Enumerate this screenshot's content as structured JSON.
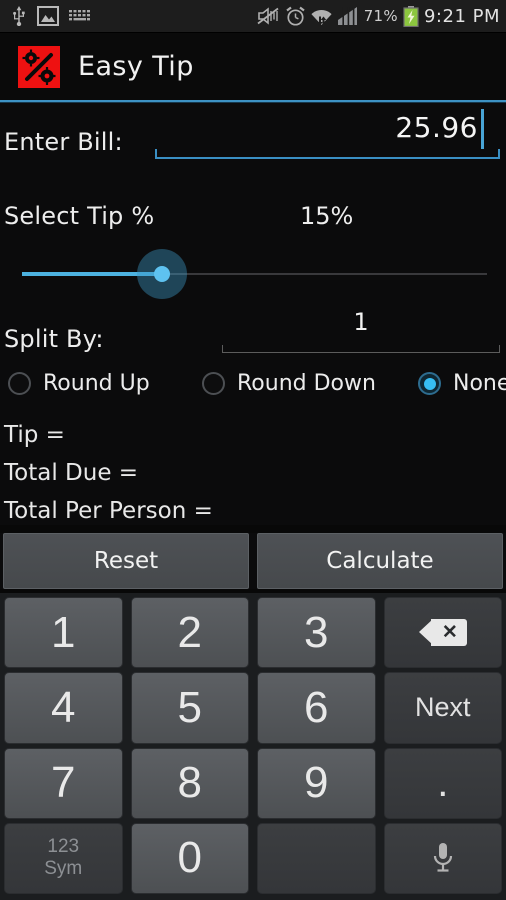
{
  "statusbar": {
    "left_icons": [
      "usb-icon",
      "screenshot-image-icon",
      "keyboard-icon"
    ],
    "right_icons": [
      "mute-vibrate-off-icon",
      "alarm-clock-icon",
      "wifi-icon",
      "signal-bars-icon",
      "battery-charging-icon"
    ],
    "battery_percent": "71%",
    "clock": "9:21 PM"
  },
  "titlebar": {
    "app_icon": "percent-gear-icon",
    "title": "Easy Tip",
    "icon_color": "#ee1111",
    "divider_color": "#3d92c4"
  },
  "form": {
    "bill": {
      "label": "Enter Bill:",
      "value": "25.96",
      "placeholder": "",
      "underline_color": "#3a8fc4"
    },
    "tip": {
      "label": "Select Tip %",
      "percent_display": "15%",
      "slider_value": 15,
      "slider_min": 0,
      "slider_max": 50,
      "slider_fill_pct": 30,
      "accent_color": "#4cb2e0"
    },
    "split": {
      "label": "Split By:",
      "value": "1",
      "placeholder": ""
    },
    "rounding": {
      "options": [
        {
          "label": "Round Up",
          "selected": false
        },
        {
          "label": "Round Down",
          "selected": false
        },
        {
          "label": "None",
          "selected": true
        }
      ]
    },
    "results": [
      "Tip =",
      "Total Due =",
      "Total Per Person ="
    ]
  },
  "actions": {
    "reset_label": "Reset",
    "calculate_label": "Calculate"
  },
  "keyboard": {
    "rows": [
      [
        {
          "label": "1",
          "type": "num",
          "name": "key-1"
        },
        {
          "label": "2",
          "type": "num",
          "name": "key-2"
        },
        {
          "label": "3",
          "type": "num",
          "name": "key-3"
        },
        {
          "label": "",
          "type": "backspace",
          "name": "key-backspace"
        }
      ],
      [
        {
          "label": "4",
          "type": "num",
          "name": "key-4"
        },
        {
          "label": "5",
          "type": "num",
          "name": "key-5"
        },
        {
          "label": "6",
          "type": "num",
          "name": "key-6"
        },
        {
          "label": "Next",
          "type": "fn",
          "name": "key-next"
        }
      ],
      [
        {
          "label": "7",
          "type": "num",
          "name": "key-7"
        },
        {
          "label": "8",
          "type": "num",
          "name": "key-8"
        },
        {
          "label": "9",
          "type": "num",
          "name": "key-9"
        },
        {
          "label": ".",
          "type": "dot",
          "name": "key-period"
        }
      ],
      [
        {
          "label": "123\nSym",
          "type": "sym",
          "name": "key-123-sym"
        },
        {
          "label": "0",
          "type": "num",
          "name": "key-0"
        },
        {
          "label": "",
          "type": "blank",
          "name": "key-blank"
        },
        {
          "label": "",
          "type": "mic",
          "name": "key-microphone"
        }
      ]
    ],
    "sym_line1": "123",
    "sym_line2": "Sym"
  }
}
